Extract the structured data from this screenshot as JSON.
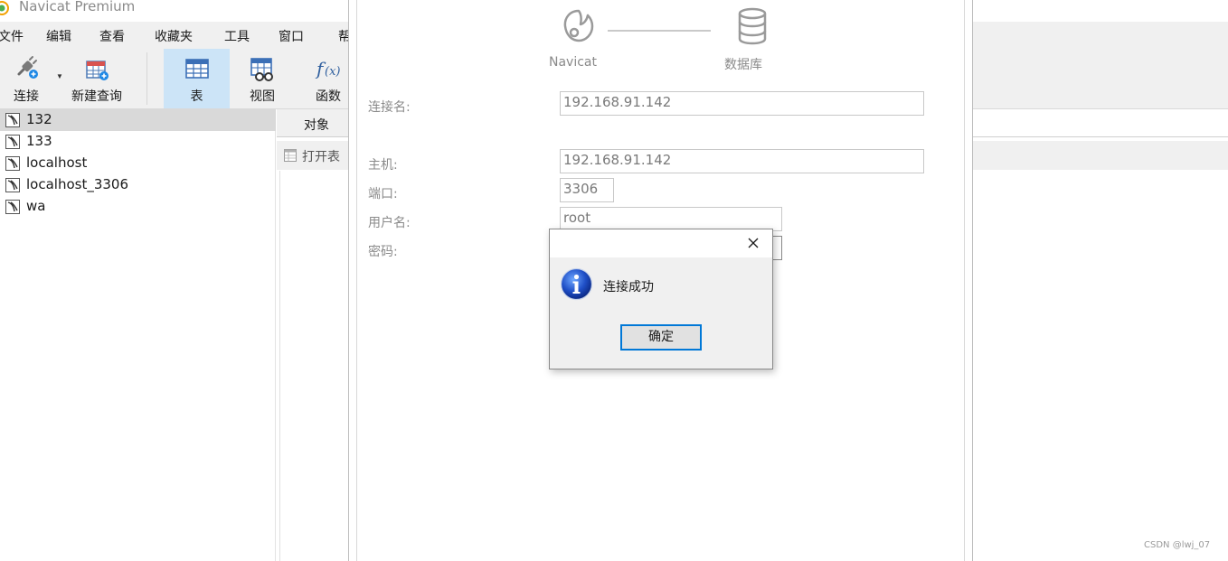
{
  "window": {
    "title": "Navicat Premium"
  },
  "menu": {
    "items": [
      "文件",
      "编辑",
      "查看",
      "收藏夹",
      "工具",
      "窗口",
      "帮"
    ]
  },
  "toolbar": {
    "connect_label": "连接",
    "new_query_label": "新建查询",
    "table_label": "表",
    "view_label": "视图",
    "function_label": "函数",
    "active_item": "表"
  },
  "connections": {
    "items": [
      "132",
      "133",
      "localhost",
      "localhost_3306",
      "wa"
    ],
    "selected": "132"
  },
  "object_area": {
    "tab_label": "对象",
    "open_table_label": "打开表"
  },
  "connection_dialog": {
    "source_caption": "Navicat",
    "target_caption": "数据库",
    "fields": {
      "connection_name_label": "连接名:",
      "connection_name_value": "192.168.91.142",
      "host_label": "主机:",
      "host_value": "192.168.91.142",
      "port_label": "端口:",
      "port_value": "3306",
      "username_label": "用户名:",
      "username_value": "root",
      "password_label": "密码:"
    }
  },
  "message_box": {
    "message": "连接成功",
    "ok_label": "确定",
    "icon": "info-icon"
  },
  "watermark": "CSDN @lwj_07",
  "colors": {
    "accent": "#0078d7",
    "active_tool_bg": "#cce4f7",
    "selected_row_bg": "#d9d9d9",
    "chrome_bg": "#f0f0f0"
  }
}
